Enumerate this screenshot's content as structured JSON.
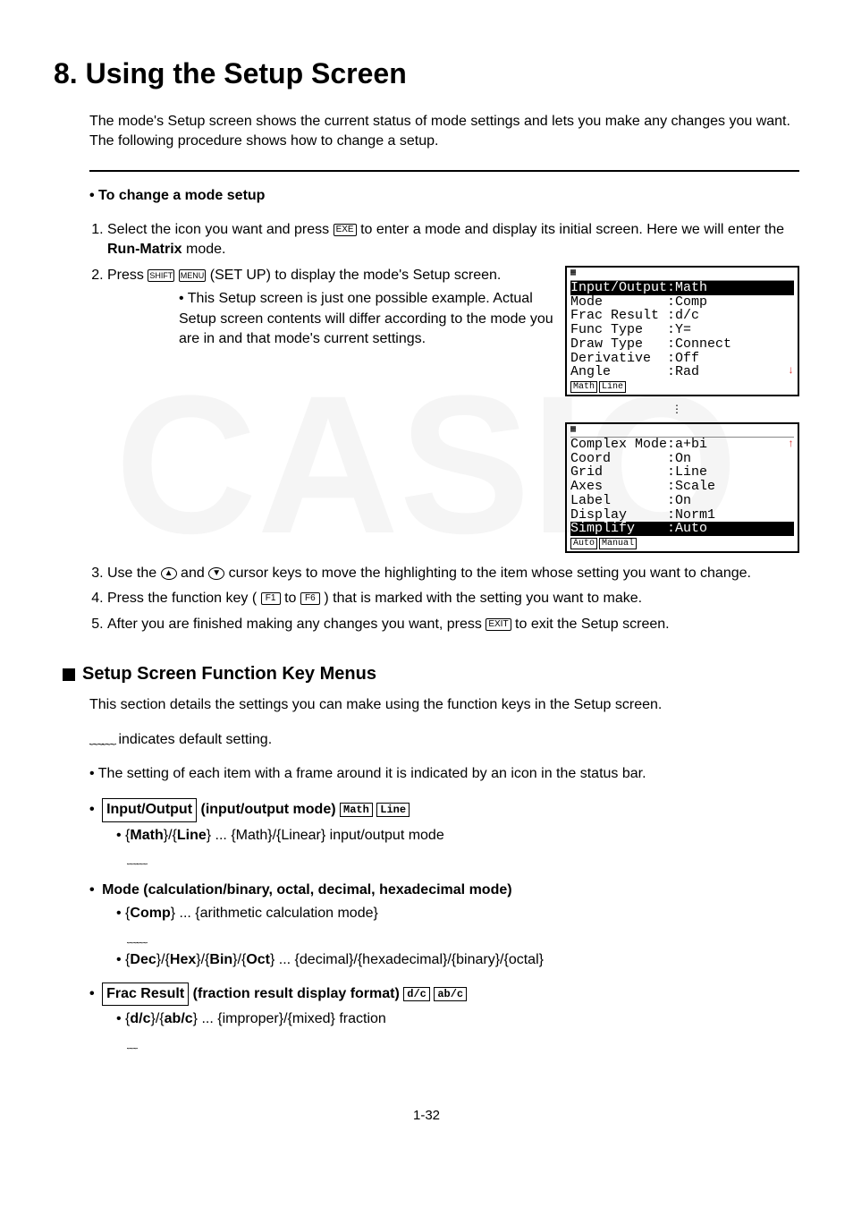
{
  "title": "8. Using the Setup Screen",
  "intro": "The mode's Setup screen shows the current status of mode settings and lets you make any changes you want. The following procedure shows how to change a setup.",
  "proc_head": "To change a mode setup",
  "step1_a": "Select the icon you want and press ",
  "step1_b": " to enter a mode and display its initial screen. Here we will enter the ",
  "step1_mode": "Run-Matrix",
  "step1_c": " mode.",
  "step2_a": "Press ",
  "step2_b": " (SET UP) to display the mode's Setup screen.",
  "step2_note": "This Setup screen is just one possible example. Actual Setup screen contents will differ according to the mode you are in and that mode's current settings.",
  "screen1": {
    "rows": [
      "Input/Output:Math",
      "Mode        :Comp",
      "Frac Result :d/c",
      "Func Type   :Y=",
      "Draw Type   :Connect",
      "Derivative  :Off",
      "Angle       :Rad"
    ],
    "hl_index": 0,
    "fn": [
      "Math",
      "Line"
    ]
  },
  "screen2": {
    "rows": [
      "Complex Mode:a+bi",
      "Coord       :On",
      "Grid        :Line",
      "Axes        :Scale",
      "Label       :On",
      "Display     :Norm1",
      "Simplify    :Auto"
    ],
    "hl_index": 6,
    "fn": [
      "Auto",
      "Manual"
    ]
  },
  "step3": "Use the Ⓐ and Ⓑ cursor keys to move the highlighting to the item whose setting you want to change.",
  "step3_plain_a": "Use the ",
  "step3_plain_b": " and ",
  "step3_plain_c": " cursor keys to move the highlighting to the item whose setting you want to change.",
  "step4_a": "Press the function key (",
  "step4_b": " to ",
  "step4_c": ") that is marked with the setting you want to make.",
  "step5_a": "After you are finished making any changes you want, press ",
  "step5_b": " to exit the Setup screen.",
  "sec2_title": "Setup Screen Function Key Menus",
  "sec2_p1": "This section details the settings you can make using the function keys in the Setup screen.",
  "sec2_p2": " indicates default setting.",
  "sec2_p3": "The setting of each item with a frame around it is indicated by an icon in the status bar.",
  "s_io_box": "Input/Output",
  "s_io_label": " (input/output mode) ",
  "s_io_icons": [
    "Math",
    "Line"
  ],
  "s_io_opt": "{Math}/{Line} ... {Math}/{Linear} input/output mode",
  "s_io_opt_bold": "Math",
  "s_mode_label": "Mode (calculation/binary, octal, decimal, hexadecimal mode)",
  "s_mode_opt1_bold": "Comp",
  "s_mode_opt1_rest": " ... {arithmetic calculation mode}",
  "s_mode_opt2": "{Dec}/{Hex}/{Bin}/{Oct} ... {decimal}/{hexadecimal}/{binary}/{octal}",
  "s_frac_box": "Frac Result",
  "s_frac_label": " (fraction result display format) ",
  "s_frac_icons": [
    "d/c",
    "ab/c"
  ],
  "s_frac_opt": "{d/c}/{ab/c} ... {improper}/{mixed} fraction",
  "keys": {
    "exe": "EXE",
    "shift": "SHIFT",
    "menu": "MENU",
    "f1": "F1",
    "f6": "F6",
    "exit": "EXIT",
    "up": "▲",
    "down": "▼"
  },
  "pagenum": "1-32"
}
